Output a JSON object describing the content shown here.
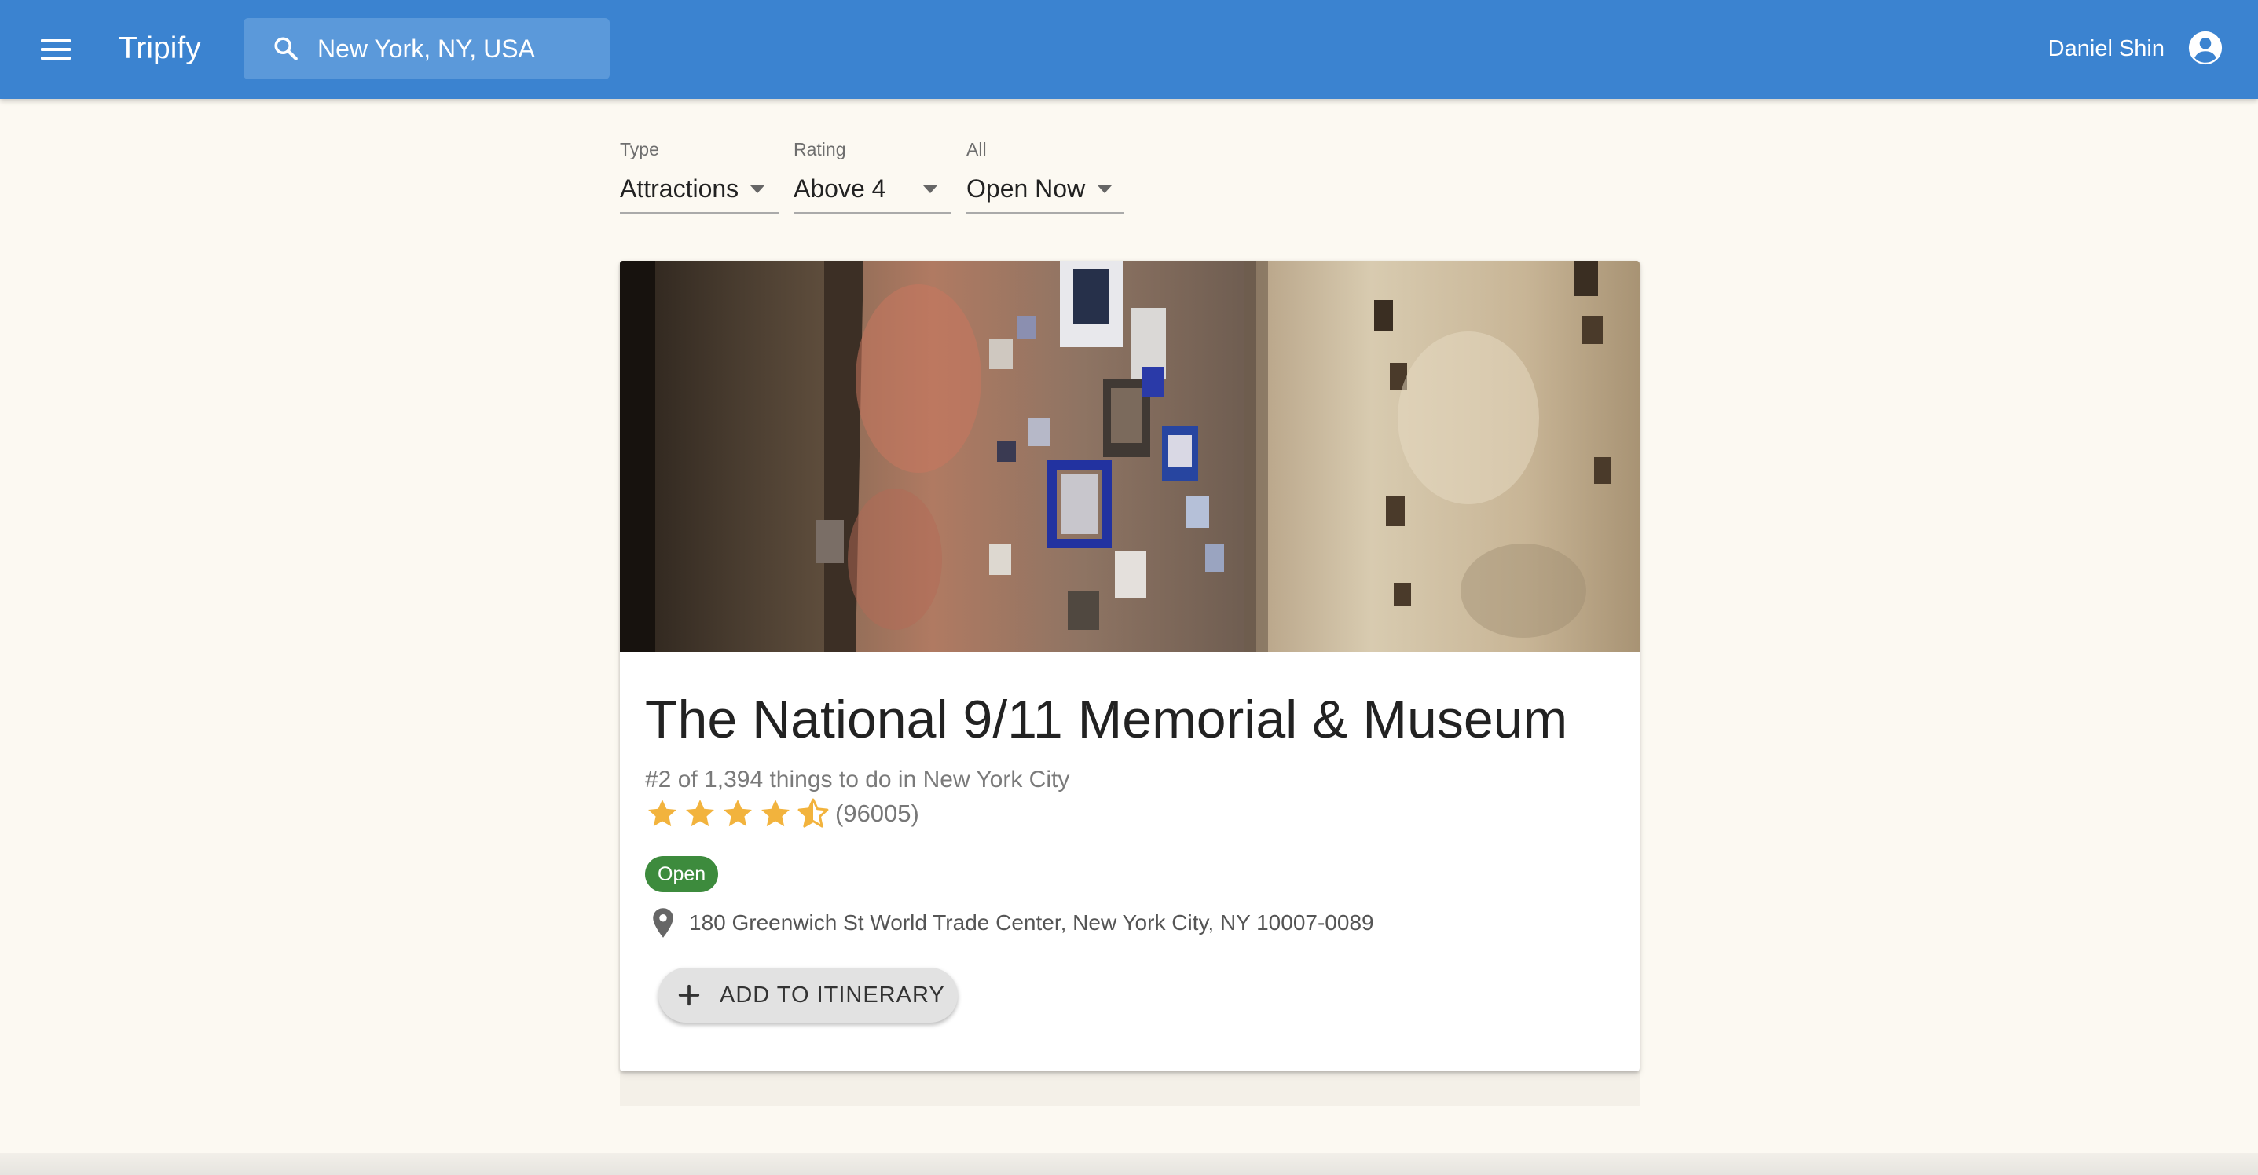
{
  "app": {
    "title": "Tripify"
  },
  "header": {
    "search_value": "New York, NY, USA",
    "user_name": "Daniel Shin"
  },
  "filters": [
    {
      "label": "Type",
      "value": "Attractions"
    },
    {
      "label": "Rating",
      "value": "Above 4"
    },
    {
      "label": "All",
      "value": "Open Now"
    }
  ],
  "place": {
    "title": "The National 9/11 Memorial & Museum",
    "ranking": "#2 of 1,394 things to do in New York City",
    "rating": 4.5,
    "rating_max": 5,
    "review_count": "(96005)",
    "status": "Open",
    "address": "180 Greenwich St World Trade Center, New York City, NY 10007-0089",
    "add_button_label": "ADD TO ITINERARY"
  },
  "colors": {
    "app_bar": "#3b83d0",
    "background": "#fcf9f2",
    "star": "#f2b33d",
    "open_chip": "#3d8b3d"
  }
}
